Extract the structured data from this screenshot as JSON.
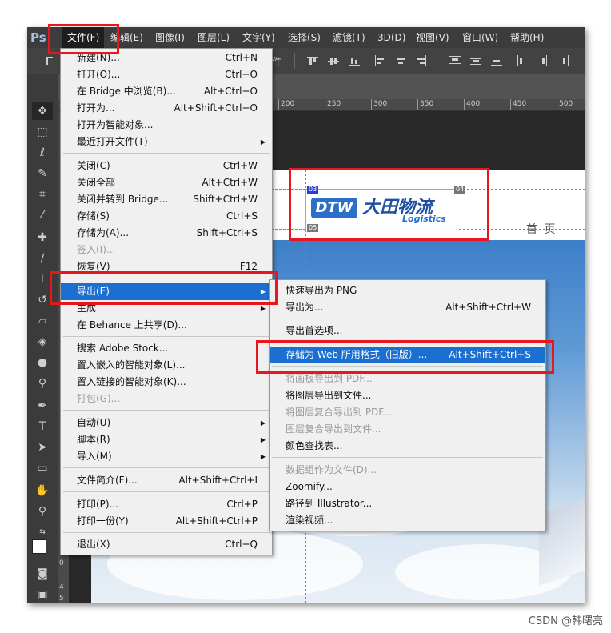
{
  "app": {
    "logo": "Ps"
  },
  "menubar": [
    {
      "label": "文件(F)",
      "active": true
    },
    {
      "label": "编辑(E)"
    },
    {
      "label": "图像(I)"
    },
    {
      "label": "图层(L)"
    },
    {
      "label": "文字(Y)"
    },
    {
      "label": "选择(S)"
    },
    {
      "label": "滤镜(T)"
    },
    {
      "label": "3D(D)"
    },
    {
      "label": "视图(V)"
    },
    {
      "label": "窗口(W)"
    },
    {
      "label": "帮助(H)"
    }
  ],
  "optionsbar": {
    "partial_label": "件"
  },
  "rulers": {
    "top": [
      "200",
      "250",
      "300",
      "350",
      "400",
      "450",
      "500"
    ],
    "left": [
      "0",
      "4",
      "5"
    ]
  },
  "file_menu": [
    {
      "label": "新建(N)...",
      "shortcut": "Ctrl+N"
    },
    {
      "label": "打开(O)...",
      "shortcut": "Ctrl+O"
    },
    {
      "label": "在 Bridge 中浏览(B)...",
      "shortcut": "Alt+Ctrl+O"
    },
    {
      "label": "打开为...",
      "shortcut": "Alt+Shift+Ctrl+O"
    },
    {
      "label": "打开为智能对象..."
    },
    {
      "label": "最近打开文件(T)",
      "submenu": true
    },
    {
      "label": "关闭(C)",
      "shortcut": "Ctrl+W"
    },
    {
      "label": "关闭全部",
      "shortcut": "Alt+Ctrl+W"
    },
    {
      "label": "关闭并转到 Bridge...",
      "shortcut": "Shift+Ctrl+W"
    },
    {
      "label": "存储(S)",
      "shortcut": "Ctrl+S"
    },
    {
      "label": "存储为(A)...",
      "shortcut": "Shift+Ctrl+S"
    },
    {
      "label": "签入(I)...",
      "disabled": true
    },
    {
      "label": "恢复(V)",
      "shortcut": "F12"
    },
    {
      "label": "导出(E)",
      "submenu": true,
      "highlight": true
    },
    {
      "label": "生成",
      "submenu": true
    },
    {
      "label": "在 Behance 上共享(D)..."
    },
    {
      "label": "搜索 Adobe Stock..."
    },
    {
      "label": "置入嵌入的智能对象(L)..."
    },
    {
      "label": "置入链接的智能对象(K)..."
    },
    {
      "label": "打包(G)...",
      "disabled": true
    },
    {
      "label": "自动(U)",
      "submenu": true
    },
    {
      "label": "脚本(R)",
      "submenu": true
    },
    {
      "label": "导入(M)",
      "submenu": true
    },
    {
      "label": "文件简介(F)...",
      "shortcut": "Alt+Shift+Ctrl+I"
    },
    {
      "label": "打印(P)...",
      "shortcut": "Ctrl+P"
    },
    {
      "label": "打印一份(Y)",
      "shortcut": "Alt+Shift+Ctrl+P"
    },
    {
      "label": "退出(X)",
      "shortcut": "Ctrl+Q"
    }
  ],
  "export_menu": [
    {
      "label": "快速导出为 PNG"
    },
    {
      "label": "导出为...",
      "shortcut": "Alt+Shift+Ctrl+W"
    },
    {
      "label": "导出首选项..."
    },
    {
      "label": "存储为 Web 所用格式（旧版）...",
      "shortcut": "Alt+Shift+Ctrl+S",
      "highlight": true
    },
    {
      "label": "将画板导出到 PDF...",
      "disabled": true
    },
    {
      "label": "将图层导出到文件..."
    },
    {
      "label": "将图层复合导出到 PDF...",
      "disabled": true
    },
    {
      "label": "图层复合导出到文件...",
      "disabled": true
    },
    {
      "label": "颜色查找表..."
    },
    {
      "label": "数据组作为文件(D)...",
      "disabled": true
    },
    {
      "label": "Zoomify..."
    },
    {
      "label": "路径到 Illustrator..."
    },
    {
      "label": "渲染视频..."
    }
  ],
  "document": {
    "home_link": "首 页",
    "logo_dtw": "DTW",
    "logo_cn": "大田物流",
    "logo_en": "Logistics",
    "slice_tags": [
      "03",
      "04",
      "05"
    ]
  },
  "colors": {
    "highlight": "#1a6fd1",
    "annotation": "#e8171e"
  },
  "watermark": "CSDN @韩曙亮"
}
